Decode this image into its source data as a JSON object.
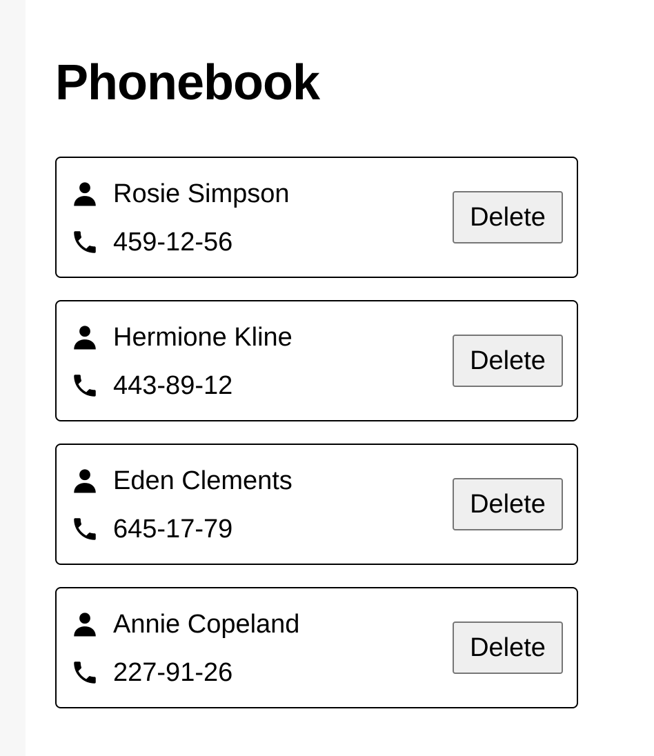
{
  "page": {
    "title": "Phonebook"
  },
  "contacts": [
    {
      "name": "Rosie Simpson",
      "number": "459-12-56",
      "delete_label": "Delete"
    },
    {
      "name": "Hermione Kline",
      "number": "443-89-12",
      "delete_label": "Delete"
    },
    {
      "name": "Eden Clements",
      "number": "645-17-79",
      "delete_label": "Delete"
    },
    {
      "name": "Annie Copeland",
      "number": "227-91-26",
      "delete_label": "Delete"
    }
  ],
  "icons": {
    "name": "person-icon",
    "number": "phone-icon"
  },
  "colors": {
    "background": "#ffffff",
    "side_strip": "#f7f7f7",
    "card_border": "#000000",
    "button_background": "#efefef",
    "button_border": "#767676"
  }
}
